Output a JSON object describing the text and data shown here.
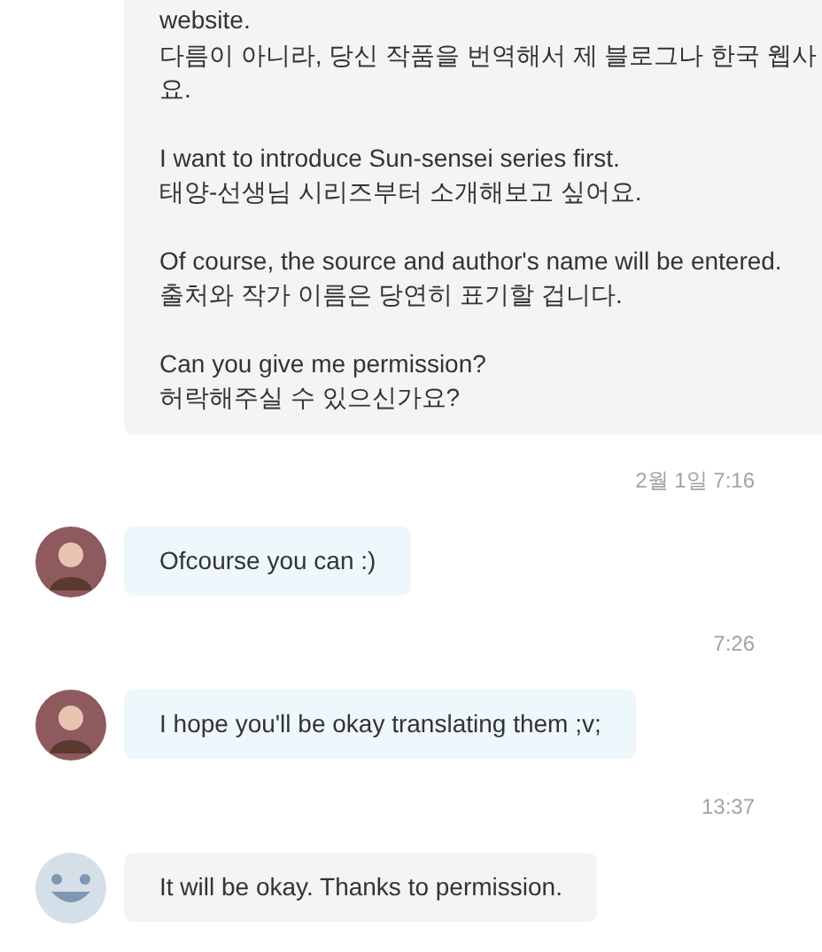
{
  "messages": [
    {
      "kind": "sent",
      "paragraphs": [
        [
          "website.",
          "다름이 아니라, 당신 작품을 번역해서 제 블로그나 한국 웹사",
          "요."
        ],
        [
          "I want to introduce Sun-sensei series first.",
          "태양-선생님 시리즈부터 소개해보고 싶어요."
        ],
        [
          "Of course, the source and author's name will be entered.",
          "출처와 작가 이름은 당연히 표기할 겁니다."
        ],
        [
          "Can you give me permission?",
          "허락해주실 수 있으신가요?"
        ]
      ]
    },
    {
      "kind": "time",
      "text": "2월 1일 7:16"
    },
    {
      "kind": "received",
      "avatar": {
        "kind": "picture"
      },
      "paragraphs": [
        [
          "Ofcourse you can :)"
        ]
      ]
    },
    {
      "kind": "time",
      "text": "7:26"
    },
    {
      "kind": "received",
      "avatar": {
        "kind": "picture"
      },
      "paragraphs": [
        [
          "I hope you'll be okay translating them ;v;"
        ]
      ]
    },
    {
      "kind": "time",
      "text": "13:37"
    },
    {
      "kind": "sent",
      "avatar": {
        "kind": "placeholder"
      },
      "paragraphs": [
        [
          "It will be okay. Thanks to permission."
        ]
      ]
    }
  ]
}
